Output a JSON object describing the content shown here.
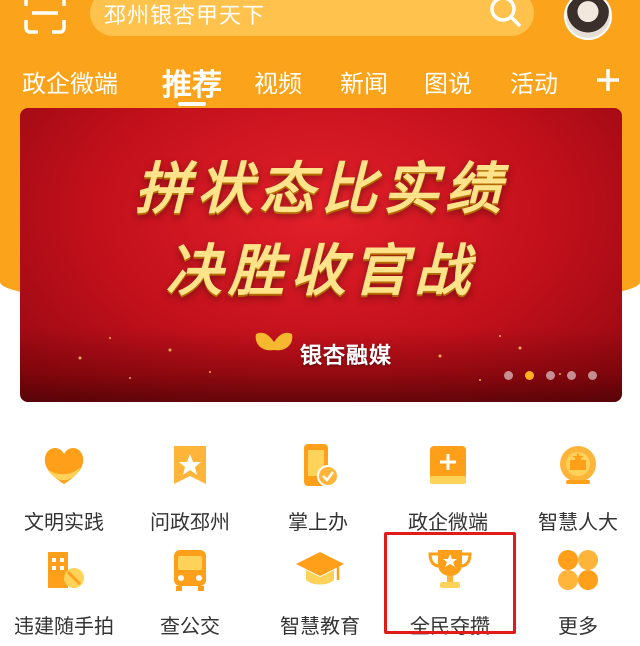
{
  "header": {
    "search_text": "邳州银杏甲天下",
    "colors": {
      "primary": "#fba31a",
      "icon_orange": "#ff9f1a",
      "highlight": "#e21a1a"
    }
  },
  "tabs": [
    {
      "label": "政企微端",
      "active": false
    },
    {
      "label": "推荐",
      "active": true
    },
    {
      "label": "视频",
      "active": false
    },
    {
      "label": "新闻",
      "active": false
    },
    {
      "label": "图说",
      "active": false
    },
    {
      "label": "活动",
      "active": false
    }
  ],
  "banner": {
    "line1": "拼状态比实绩",
    "line2": "决胜收官战",
    "logo_text": "银杏融媒",
    "slides_total": 5,
    "slide_active_index": 1
  },
  "grid": {
    "row1": [
      {
        "label": "文明实践",
        "icon": "heart-ribbon-icon"
      },
      {
        "label": "问政邳州",
        "icon": "star-badge-icon"
      },
      {
        "label": "掌上办",
        "icon": "mobile-check-icon"
      },
      {
        "label": "政企微端",
        "icon": "plus-box-icon"
      },
      {
        "label": "智慧人大",
        "icon": "emblem-icon"
      }
    ],
    "row2": [
      {
        "label": "违建随手拍",
        "icon": "building-camera-icon"
      },
      {
        "label": "查公交",
        "icon": "bus-icon"
      },
      {
        "label": "智慧教育",
        "icon": "graduation-cap-icon"
      },
      {
        "label": "全民夺攒",
        "icon": "trophy-icon"
      },
      {
        "label": "更多",
        "icon": "more-grid-icon"
      }
    ]
  }
}
